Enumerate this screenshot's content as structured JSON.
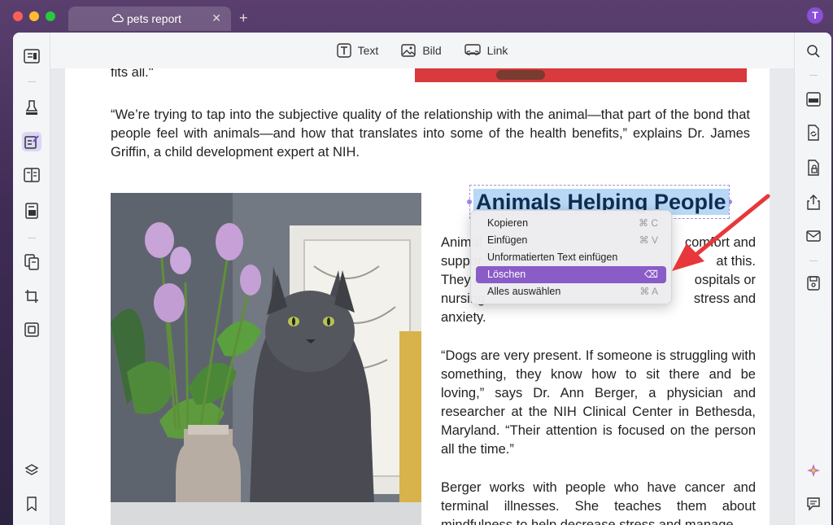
{
  "window": {
    "tab_title": "pets report",
    "avatar_initial": "T"
  },
  "toolbar": {
    "text_label": "Text",
    "image_label": "Bild",
    "link_label": "Link"
  },
  "document": {
    "top_fragment": "fits all.\"",
    "quote1": "“We’re trying to tap into the subjective quality of the relationship with the animal—that part of the bond that people feel with animals—and how that translates into some of the health benefits,” explains Dr. James Griffin, a child development expert at NIH.",
    "heading": "Animals Helping People",
    "para1_lines": [
      "Animal",
      "suppor",
      "They’re",
      "nursing",
      "anxiety."
    ],
    "para1_right_lines": [
      "comfort and",
      "at this.",
      "ospitals or",
      "stress and",
      ""
    ],
    "para2": "“Dogs are very present. If someone is struggling with something, they know how to sit there and be loving,” says Dr. Ann Berger, a physician and researcher at the NIH Clinical Center in Bethesda, Maryland. “Their attention is focused on the person all the time.”",
    "para3": "Berger works with people who have cancer and terminal illnesses. She teaches them about mindfulness to help decrease stress and manage"
  },
  "context_menu": {
    "items": [
      {
        "label": "Kopieren",
        "shortcut": "⌘ C"
      },
      {
        "label": "Einfügen",
        "shortcut": "⌘ V"
      },
      {
        "label": "Unformatierten Text einfügen",
        "shortcut": ""
      },
      {
        "label": "Löschen",
        "shortcut": "⌫"
      },
      {
        "label": "Alles auswählen",
        "shortcut": "⌘ A"
      }
    ],
    "highlighted_index": 3,
    "highlight_color": "#8a5cc8"
  },
  "colors": {
    "accent": "#8b4fd8",
    "annotation_arrow": "#e8373b"
  },
  "icons": {
    "left": [
      "reader-icon",
      "highlighter-icon",
      "edit-text-icon",
      "organize-pages-icon",
      "form-icon",
      "copy-pages-icon",
      "crop-icon",
      "compress-icon",
      "layers-icon",
      "bookmark-icon"
    ],
    "right": [
      "search-icon",
      "ocr-icon",
      "convert-icon",
      "protect-icon",
      "share-icon",
      "mail-icon",
      "save-icon",
      "ai-assistant-icon",
      "comment-icon"
    ]
  }
}
